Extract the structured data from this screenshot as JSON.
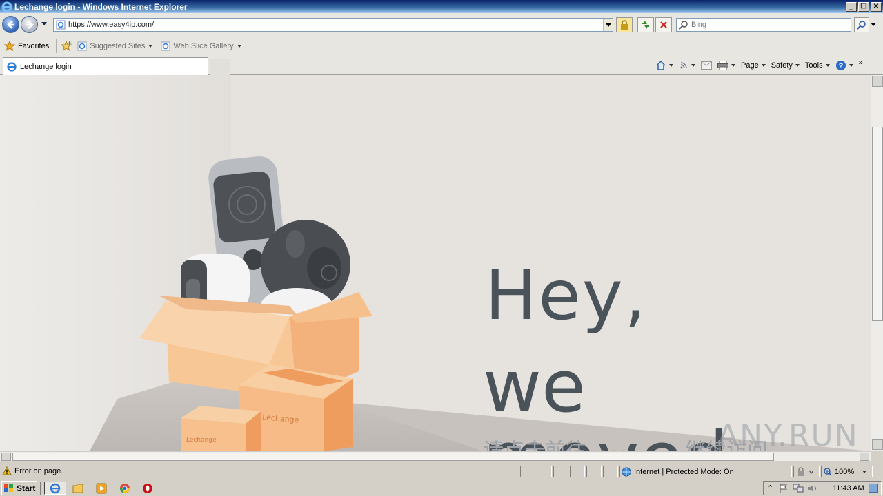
{
  "window": {
    "title": "Lechange login - Windows Internet Explorer"
  },
  "address": {
    "url": "https://www.easy4ip.com/"
  },
  "search": {
    "placeholder": "Bing"
  },
  "favorites_bar": {
    "favorites_label": "Favorites",
    "items": [
      {
        "label": "Suggested Sites"
      },
      {
        "label": "Web Slice Gallery"
      }
    ]
  },
  "tabs": [
    {
      "label": "Lechange login"
    }
  ],
  "command_bar": {
    "page": "Page",
    "safety": "Safety",
    "tools": "Tools"
  },
  "content": {
    "heading_line1": "Hey,",
    "heading_line2": "we moved..",
    "cn_left": "请点击前往",
    "cn_mid": "...",
    "cn_right": "继续访问",
    "watermark": "ANY.RUN",
    "box_brand": "Lechange",
    "small_box_brand": "Lechange"
  },
  "statusbar": {
    "error": "Error on page.",
    "zone": "Internet | Protected Mode: On",
    "zoom": "100%"
  },
  "taskbar": {
    "start": "Start",
    "clock": "11:43 AM"
  },
  "colors": {
    "heading": "#4a525a",
    "accent": "#e28b3a",
    "box": "#f5c48e"
  }
}
